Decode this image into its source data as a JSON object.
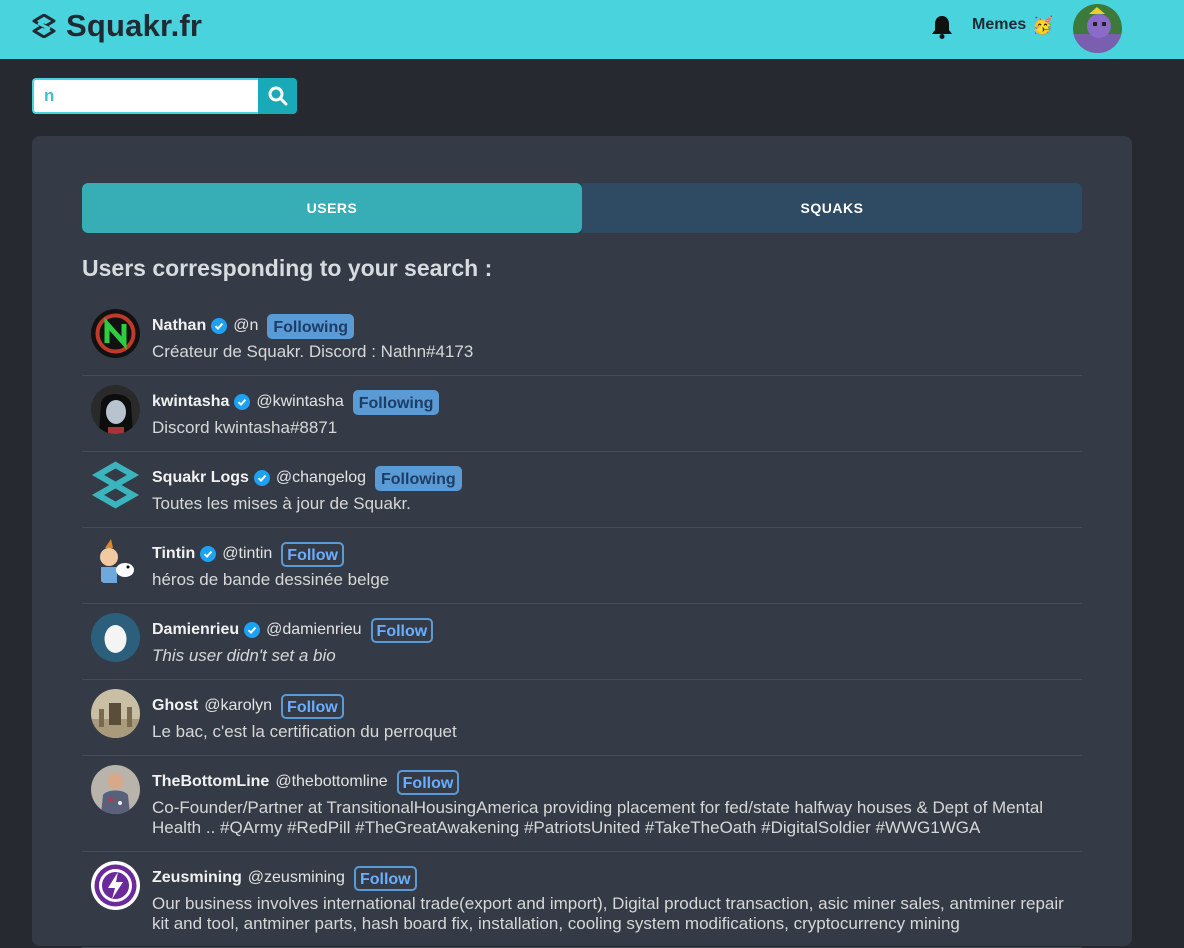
{
  "header": {
    "brand": "Squakr.fr",
    "memes_label": "Memes",
    "memes_emoji": "🥳"
  },
  "search": {
    "value": "n",
    "placeholder": ""
  },
  "tabs": [
    {
      "label": "USERS",
      "active": true
    },
    {
      "label": "SQUAKS",
      "active": false
    }
  ],
  "results_title": "Users corresponding to your search :",
  "users": [
    {
      "name": "Nathan",
      "verified": true,
      "handle": "@n",
      "button": "Following",
      "bio": "Créateur de Squakr. Discord : Nathn#4173"
    },
    {
      "name": "kwintasha",
      "verified": true,
      "handle": "@kwintasha",
      "button": "Following",
      "bio": "Discord kwintasha#8871"
    },
    {
      "name": "Squakr Logs",
      "verified": true,
      "handle": "@changelog",
      "button": "Following",
      "bio": "Toutes les mises à jour de Squakr."
    },
    {
      "name": "Tintin",
      "verified": true,
      "handle": "@tintin",
      "button": "Follow",
      "bio": "héros de bande dessinée belge"
    },
    {
      "name": "Damienrieu",
      "verified": true,
      "handle": "@damienrieu",
      "button": "Follow",
      "bio": "This user didn't set a bio"
    },
    {
      "name": "Ghost",
      "verified": false,
      "handle": "@karolyn",
      "button": "Follow",
      "bio": "Le bac, c'est la certification du perroquet"
    },
    {
      "name": "TheBottomLine",
      "verified": false,
      "handle": "@thebottomline",
      "button": "Follow",
      "bio": "Co-Founder/Partner at TransitionalHousingAmerica providing placement for fed/state halfway houses & Dept of Mental Health .. #QArmy #RedPill #TheGreatAwakening #PatriotsUnited #TakeTheOath #DigitalSoldier #WWG1WGA"
    },
    {
      "name": "Zeusmining",
      "verified": false,
      "handle": "@zeusmining",
      "button": "Follow",
      "bio": "Our business involves international trade(export and import), Digital product transaction, asic miner sales, antminer repair kit and tool, antminer parts, hash board fix, installation, cooling system modifications, cryptocurrency mining"
    }
  ],
  "colors": {
    "topbar": "#49d3dc",
    "background": "#262a30",
    "panel": "#343b46",
    "tab_active": "#37adb6",
    "tab_inactive": "#2f4a63",
    "follow_button": "#5b9bd5",
    "verified_badge": "#1da1f2"
  }
}
